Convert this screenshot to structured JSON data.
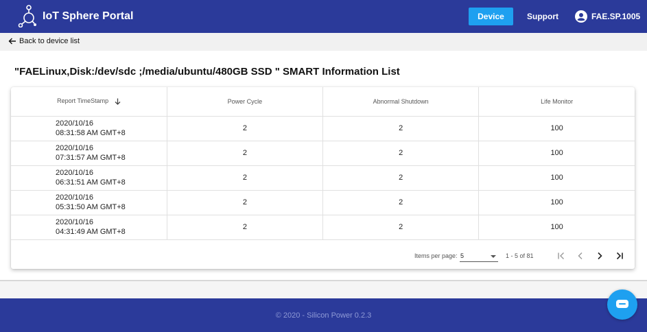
{
  "header": {
    "app_title": "IoT Sphere Portal",
    "nav": {
      "device": "Device",
      "support": "Support"
    },
    "user": "FAE.SP.1005",
    "colors": {
      "navbar": "#2b3a9a",
      "active": "#1ea0f0"
    }
  },
  "back_link": "Back to device list",
  "page_title": "\"FAELinux,Disk:/dev/sdc ;/media/ubuntu/480GB SSD \" SMART Information List",
  "table": {
    "columns": [
      "Report TimeStamp",
      "Power Cycle",
      "Abnormal Shutdown",
      "Life Monitor"
    ],
    "rows": [
      {
        "date": "2020/10/16",
        "time": "08:31:58 AM GMT+8",
        "power_cycle": "2",
        "abnormal_shutdown": "2",
        "life_monitor": "100"
      },
      {
        "date": "2020/10/16",
        "time": "07:31:57 AM GMT+8",
        "power_cycle": "2",
        "abnormal_shutdown": "2",
        "life_monitor": "100"
      },
      {
        "date": "2020/10/16",
        "time": "06:31:51 AM GMT+8",
        "power_cycle": "2",
        "abnormal_shutdown": "2",
        "life_monitor": "100"
      },
      {
        "date": "2020/10/16",
        "time": "05:31:50 AM GMT+8",
        "power_cycle": "2",
        "abnormal_shutdown": "2",
        "life_monitor": "100"
      },
      {
        "date": "2020/10/16",
        "time": "04:31:49 AM GMT+8",
        "power_cycle": "2",
        "abnormal_shutdown": "2",
        "life_monitor": "100"
      }
    ]
  },
  "paginator": {
    "items_per_page_label": "Items per page:",
    "items_per_page": "5",
    "range": "1 - 5 of 81"
  },
  "footer": "© 2020 - Silicon Power 0.2.3",
  "icons": [
    "hub-logo-icon",
    "account-circle-icon",
    "arrow-back-icon",
    "sort-arrow-down-icon",
    "first-page-icon",
    "prev-page-icon",
    "next-page-icon",
    "last-page-icon",
    "chat-icon"
  ]
}
